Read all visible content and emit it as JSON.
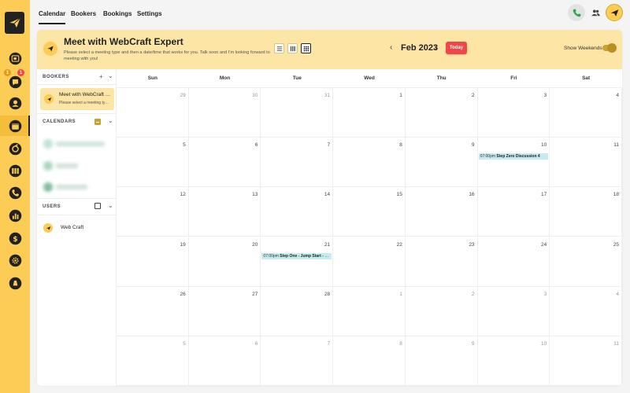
{
  "nav": {
    "tabs": [
      {
        "label": "Calendar",
        "active": true
      },
      {
        "label": "Bookers",
        "active": false
      },
      {
        "label": "Bookings",
        "active": false
      },
      {
        "label": "Settings",
        "active": false
      }
    ]
  },
  "rail": {
    "badges": {
      "conversations_left": "1",
      "conversations_right": "1"
    },
    "icons": [
      "contacts-icon",
      "conversations-icon",
      "contact-profile-icon",
      "calendar-icon",
      "opportunities-icon",
      "sites-icon",
      "phone-icon",
      "reporting-icon",
      "payments-icon",
      "settings-icon",
      "marketplace-icon"
    ]
  },
  "header": {
    "title": "Meet with WebCraft Expert",
    "subtitle": "Please select a meeting type and then a date/time that works for you. Talk soon and I'm looking forward to meeting with you!",
    "month": "Feb 2023",
    "today_label": "Today",
    "weekends_label": "Show Weekends",
    "prev_symbol": "‹",
    "next_symbol": "›"
  },
  "sidebar": {
    "bookers_label": "BOOKERS",
    "calendars_label": "CALENDARS",
    "users_label": "USERS",
    "booker": {
      "title": "Meet with WebCraft Expert",
      "subtitle": "Please select a meeting type and then a date"
    },
    "user_name": "Web Craft"
  },
  "calendar": {
    "weekdays": [
      "Sun",
      "Mon",
      "Tue",
      "Wed",
      "Thu",
      "Fri",
      "Sat"
    ],
    "weeks": [
      [
        {
          "d": "29",
          "o": true
        },
        {
          "d": "30",
          "o": true
        },
        {
          "d": "31",
          "o": true
        },
        {
          "d": "1"
        },
        {
          "d": "2"
        },
        {
          "d": "3"
        },
        {
          "d": "4"
        }
      ],
      [
        {
          "d": "5"
        },
        {
          "d": "6"
        },
        {
          "d": "7"
        },
        {
          "d": "8"
        },
        {
          "d": "9"
        },
        {
          "d": "10",
          "ev": {
            "time": "07:00pm",
            "title": "Step Zero Discussion 4"
          }
        },
        {
          "d": "11"
        }
      ],
      [
        {
          "d": "12"
        },
        {
          "d": "13"
        },
        {
          "d": "14"
        },
        {
          "d": "15"
        },
        {
          "d": "16"
        },
        {
          "d": "17"
        },
        {
          "d": "18"
        }
      ],
      [
        {
          "d": "19"
        },
        {
          "d": "20"
        },
        {
          "d": "21",
          "ev": {
            "time": "07:00pm",
            "title": "Step One - Jump Start - C..."
          }
        },
        {
          "d": "22"
        },
        {
          "d": "23"
        },
        {
          "d": "24"
        },
        {
          "d": "25"
        }
      ],
      [
        {
          "d": "26"
        },
        {
          "d": "27"
        },
        {
          "d": "28"
        },
        {
          "d": "1",
          "o": true
        },
        {
          "d": "2",
          "o": true
        },
        {
          "d": "3",
          "o": true
        },
        {
          "d": "4",
          "o": true
        }
      ],
      [
        {
          "d": "5",
          "o": true
        },
        {
          "d": "6",
          "o": true
        },
        {
          "d": "7",
          "o": true
        },
        {
          "d": "8",
          "o": true
        },
        {
          "d": "9",
          "o": true
        },
        {
          "d": "10",
          "o": true
        },
        {
          "d": "11",
          "o": true
        }
      ]
    ]
  },
  "colors": {
    "brand_yellow": "#fccc55",
    "header_bg": "#fde5a6",
    "today_red": "#ef4747",
    "event_bg": "#c6ecef",
    "toggle_on": "#caa234"
  }
}
